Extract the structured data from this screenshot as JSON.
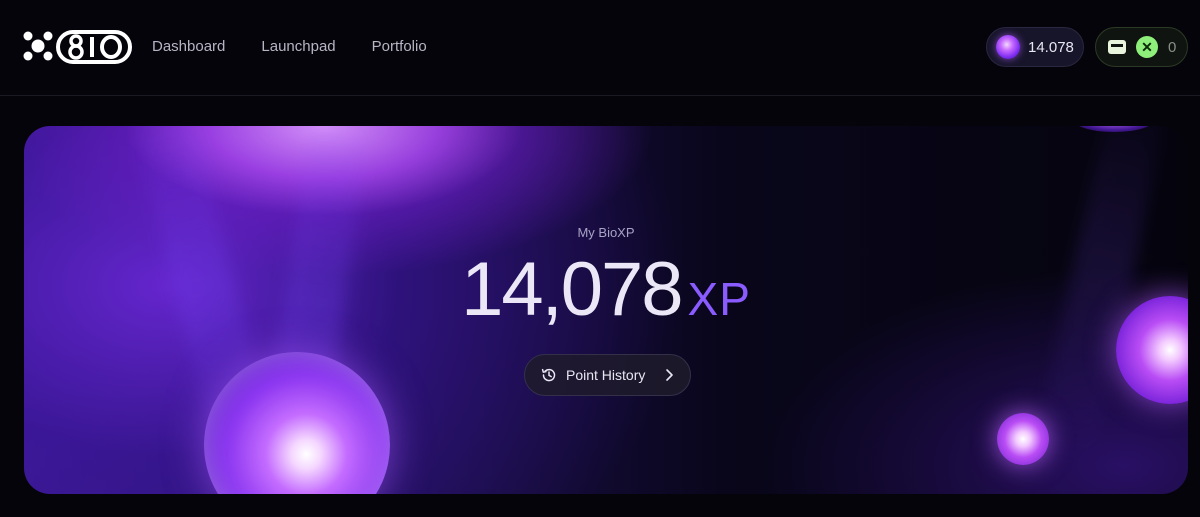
{
  "header": {
    "logo_text": "BIO",
    "nav": [
      {
        "label": "Dashboard"
      },
      {
        "label": "Launchpad"
      },
      {
        "label": "Portfolio"
      }
    ],
    "xp_balance": "14.078",
    "wallet_balance": "0",
    "icons": {
      "logo": "bio-logo-icon",
      "xp": "xp-orb-icon",
      "wallet": "wallet-icon",
      "token": "bio-token-icon"
    }
  },
  "hero": {
    "label": "My BioXP",
    "value": "14,078",
    "unit": "XP",
    "history_button": "Point History",
    "icons": {
      "history": "history-icon",
      "chevron": "chevron-right-icon"
    }
  },
  "colors": {
    "background": "#05040b",
    "accent": "#8a5cff",
    "token_green": "#8ef07a"
  }
}
